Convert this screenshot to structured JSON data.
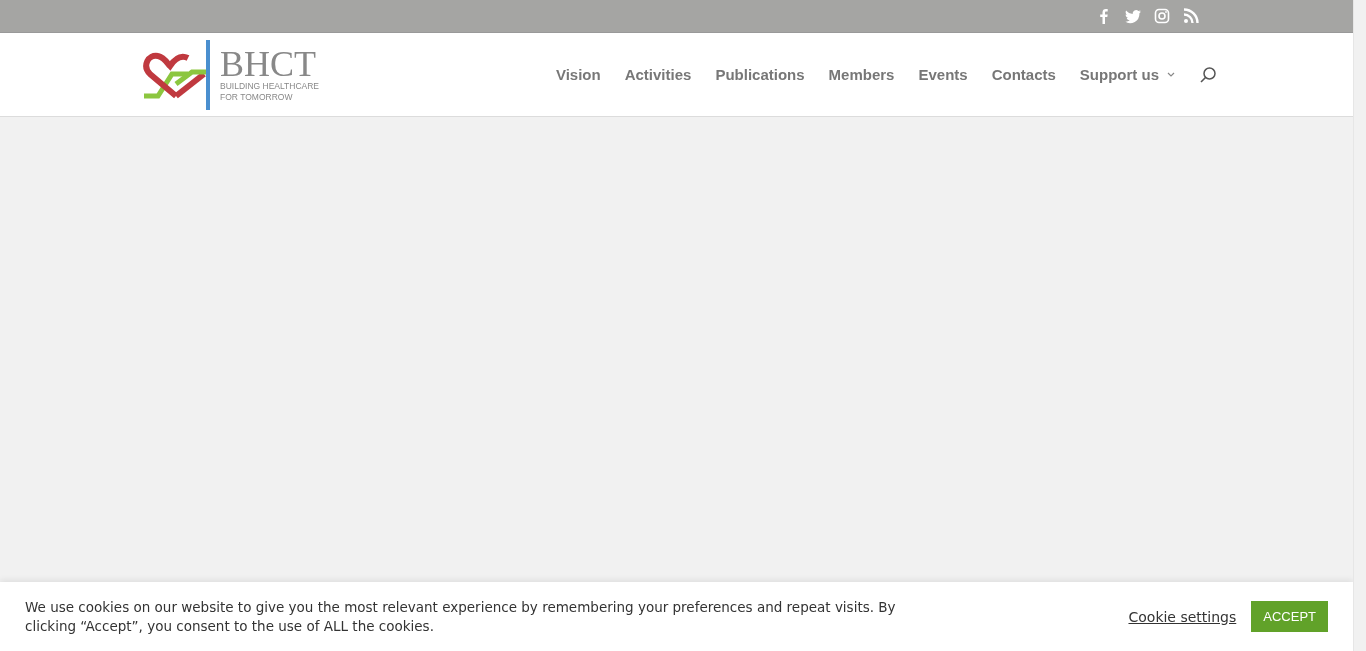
{
  "logo": {
    "wordmark": "BHCT",
    "tagline": [
      "BUILDING HEALTHCARE",
      "FOR TOMORROW"
    ]
  },
  "nav": {
    "items": [
      {
        "label": "Vision",
        "dropdown": false
      },
      {
        "label": "Activities",
        "dropdown": false
      },
      {
        "label": "Publications",
        "dropdown": false
      },
      {
        "label": "Members",
        "dropdown": false
      },
      {
        "label": "Events",
        "dropdown": false
      },
      {
        "label": "Contacts",
        "dropdown": false
      },
      {
        "label": "Support us",
        "dropdown": true
      }
    ]
  },
  "cookie_banner": {
    "message": "We use cookies on our website to give you the most relevant experience by remembering your preferences and repeat visits. By clicking “Accept”, you consent to the use of ALL the cookies.",
    "settings_link": "Cookie settings",
    "accept_button": "ACCEPT"
  }
}
